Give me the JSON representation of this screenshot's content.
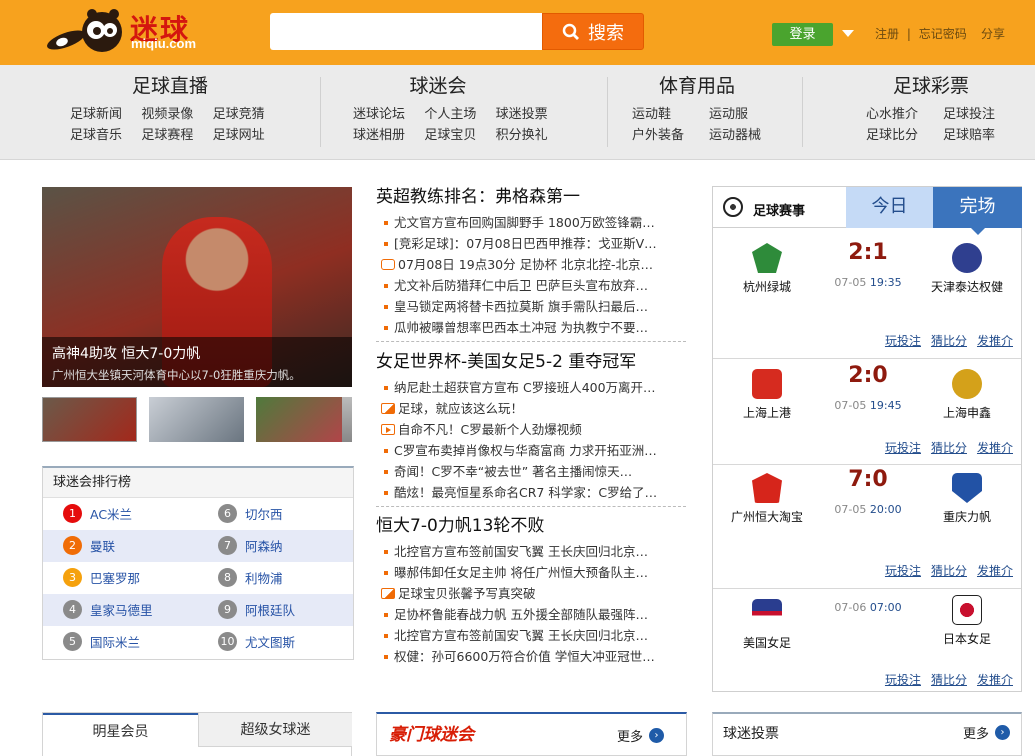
{
  "header": {
    "logo_cn": "迷球",
    "logo_en": "miqiu.com",
    "search_placeholder": "",
    "search_label": "搜索",
    "login": "登录",
    "register": "注册",
    "forgot": "忘记密码",
    "share": "分享"
  },
  "nav": [
    {
      "title": "足球直播",
      "links": [
        "足球新闻",
        "视频录像",
        "足球竞猜",
        "足球音乐",
        "足球赛程",
        "足球网址"
      ]
    },
    {
      "title": "球迷会",
      "links": [
        "迷球论坛",
        "个人主场",
        "球迷投票",
        "球迷相册",
        "足球宝贝",
        "积分换礼"
      ]
    },
    {
      "title": "体育用品",
      "links": [
        "运动鞋",
        "运动服",
        "户外装备",
        "运动器械"
      ]
    },
    {
      "title": "足球彩票",
      "links": [
        "心水推介",
        "足球投注",
        "足球比分",
        "足球赔率"
      ]
    }
  ],
  "hero": {
    "title": "高神4助攻 恒大7-0力帆",
    "subtitle": "广州恒大坐镇天河体育中心以7-0狂胜重庆力帆。"
  },
  "ranking": {
    "title": "球迷会排行榜",
    "rows": [
      [
        {
          "n": "1",
          "name": "AC米兰"
        },
        {
          "n": "6",
          "name": "切尔西"
        }
      ],
      [
        {
          "n": "2",
          "name": "曼联"
        },
        {
          "n": "7",
          "name": "阿森纳"
        }
      ],
      [
        {
          "n": "3",
          "name": "巴塞罗那"
        },
        {
          "n": "8",
          "name": "利物浦"
        }
      ],
      [
        {
          "n": "4",
          "name": "皇家马德里"
        },
        {
          "n": "9",
          "name": "阿根廷队"
        }
      ],
      [
        {
          "n": "5",
          "name": "国际米兰"
        },
        {
          "n": "10",
          "name": "尤文图斯"
        }
      ]
    ]
  },
  "bottom_tabs": {
    "tab1": "明星会员",
    "tab2": "超级女球迷"
  },
  "news": [
    {
      "title": "英超教练排名：弗格森第一",
      "items": [
        {
          "icon": "bullet",
          "text": "尤文官方宣布回购国脚野手 1800万欧签锋霸…"
        },
        {
          "icon": "bullet",
          "text": "[竞彩足球]：07月08日巴西甲推荐：戈亚斯V…"
        },
        {
          "icon": "video",
          "text": "07月08日 19点30分 足协杯 北京北控-北京…"
        },
        {
          "icon": "bullet",
          "text": "尤文补后防猎拜仁中后卫 巴萨巨头宣布放弃…"
        },
        {
          "icon": "bullet",
          "text": "皇马锁定两将替卡西拉莫斯 旗手需队扫最后…"
        },
        {
          "icon": "bullet",
          "text": "瓜帅被曝曾想率巴西本土冲冠 为执教宁不要…"
        }
      ]
    },
    {
      "title": "女足世界杯-美国女足5-2 重夺冠军",
      "items": [
        {
          "icon": "bullet",
          "text": "纳尼赴土超获官方宣布 C罗接班人400万离开…"
        },
        {
          "icon": "photo",
          "text": "足球，就应该这么玩！"
        },
        {
          "icon": "play",
          "text": "自命不凡！C罗最新个人劲爆视频"
        },
        {
          "icon": "bullet",
          "text": "C罗宣布卖掉肖像权与华裔富商 力求开拓亚洲…"
        },
        {
          "icon": "bullet",
          "text": "奇闻！C罗不幸“被去世” 著名主播闹惊天…"
        },
        {
          "icon": "bullet",
          "text": "酷炫！最亮恒星系命名CR7 科学家：C罗给了…"
        }
      ]
    },
    {
      "title": "恒大7-0力帆13轮不败",
      "items": [
        {
          "icon": "bullet",
          "text": "北控官方宣布签前国安飞翼 王长庆回归北京…"
        },
        {
          "icon": "bullet",
          "text": "曝郝伟卸任女足主帅 将任广州恒大预备队主…"
        },
        {
          "icon": "photo",
          "text": "足球宝贝张馨予写真突破"
        },
        {
          "icon": "bullet",
          "text": "足协杯鲁能春战力帆 五外援全部随队最强阵…"
        },
        {
          "icon": "bullet",
          "text": "北控官方宣布签前国安飞翼 王长庆回归北京…"
        },
        {
          "icon": "bullet",
          "text": "权健：孙可6600万符合价值 学恒大冲亚冠世…"
        }
      ]
    }
  ],
  "hao": {
    "title": "豪门球迷会",
    "more": "更多"
  },
  "matches_panel": {
    "label": "足球赛事",
    "tab_today": "今日",
    "tab_done": "完场",
    "links": [
      "玩投注",
      "猜比分",
      "发推介"
    ],
    "matches": [
      {
        "home": "杭州绿城",
        "away": "天津泰达权健",
        "score": "2:1",
        "date": "07-05",
        "time": "19:35",
        "home_color": "#2e8b3a",
        "away_color": "#2f3f8f"
      },
      {
        "home": "上海上港",
        "away": "上海申鑫",
        "score": "2:0",
        "date": "07-05",
        "time": "19:45",
        "home_color": "#d62b1f",
        "away_color": "#d4a11a"
      },
      {
        "home": "广州恒大淘宝",
        "away": "重庆力帆",
        "score": "7:0",
        "date": "07-05",
        "time": "20:00",
        "home_color": "#d6251b",
        "away_color": "#2252a5"
      },
      {
        "home": "美国女足",
        "away": "日本女足",
        "score": "",
        "date": "07-06",
        "time": "07:00",
        "home_color": "#2a3d8f",
        "away_color": "#c8102e"
      }
    ]
  },
  "vote": {
    "title": "球迷投票",
    "more": "更多"
  }
}
